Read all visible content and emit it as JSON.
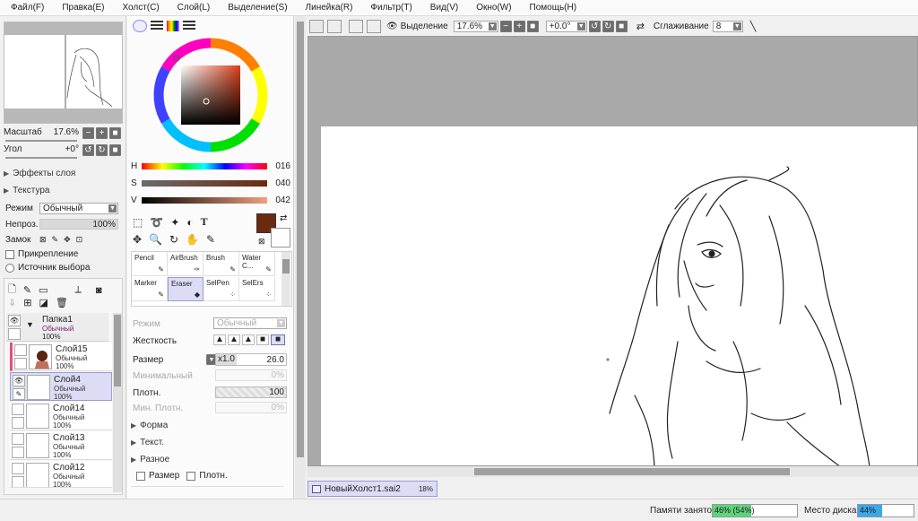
{
  "menu": [
    "Файл(F)",
    "Правка(E)",
    "Холст(C)",
    "Слой(L)",
    "Выделение(S)",
    "Линейка(R)",
    "Фильтр(T)",
    "Вид(V)",
    "Окно(W)",
    "Помощь(H)"
  ],
  "navigator": {
    "scale_label": "Масштаб",
    "scale_value": "17.6%",
    "angle_label": "Угол",
    "angle_value": "+0°"
  },
  "layer_panel": {
    "effects": "Эффекты слоя",
    "texture": "Текстура",
    "mode_label": "Режим",
    "mode_value": "Обычный",
    "opacity_label": "Непроз.",
    "opacity_value": "100%",
    "lock_label": "Замок",
    "clip_label": "Прикрепление",
    "source_label": "Источник выбора",
    "folder": {
      "name": "Папка1",
      "mode": "Обычный",
      "opacity": "100%"
    },
    "layers": [
      {
        "name": "Слой15",
        "mode": "Обычный",
        "opacity": "100%"
      },
      {
        "name": "Слой4",
        "mode": "Обычный",
        "opacity": "100%"
      },
      {
        "name": "Слой14",
        "mode": "Обычный",
        "opacity": "100%"
      },
      {
        "name": "Слой13",
        "mode": "Обычный",
        "opacity": "100%"
      },
      {
        "name": "Слой12",
        "mode": "Обычный",
        "opacity": "100%"
      }
    ]
  },
  "color": {
    "h_label": "H",
    "h_value": "016",
    "s_label": "S",
    "s_value": "040",
    "v_label": "V",
    "v_value": "042",
    "primary": "#6b2a10"
  },
  "tools": [
    {
      "name": "Pencil"
    },
    {
      "name": "AirBrush"
    },
    {
      "name": "Brush"
    },
    {
      "name": "Water C..."
    },
    {
      "name": "Marker"
    },
    {
      "name": "Eraser"
    },
    {
      "name": "SelPen"
    },
    {
      "name": "SelErs"
    }
  ],
  "brush_props": {
    "mode_label": "Режим",
    "mode_value": "Обычный",
    "hardness_label": "Жесткость",
    "size_label": "Размер",
    "size_mult": "x1.0",
    "size_value": "26.0",
    "min_label": "Минимальный",
    "min_value": "0%",
    "density_label": "Плотн.",
    "density_value": "100",
    "min_density_label": "Мин. Плотн.",
    "min_density_value": "0%",
    "shape_label": "Форма",
    "text_label": "Текст.",
    "misc_label": "Разное",
    "size_check": "Размер",
    "density_check": "Плотн."
  },
  "canvas_toolbar": {
    "selection_label": "Выделение",
    "zoom": "17.6%",
    "angle": "+0.0°",
    "smoothing_label": "Сглаживание",
    "smoothing_value": "8"
  },
  "tab": {
    "name": "НовыйХолст1.sai2",
    "zoom": "18%"
  },
  "status": {
    "memory_label": "Памяти занято",
    "memory_value": "46% (54%)",
    "memory_fraction": 0.46,
    "disk_label": "Место диска",
    "disk_value": "44%",
    "disk_fraction": 0.44
  }
}
